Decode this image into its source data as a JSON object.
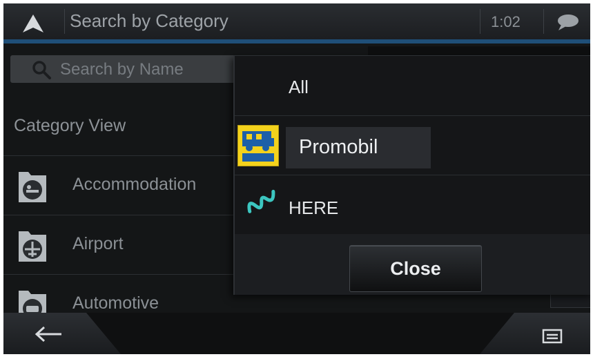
{
  "header": {
    "title": "Search by Category",
    "clock": "1:02"
  },
  "search": {
    "placeholder": "Search by Name"
  },
  "category_view": {
    "label": "Category View"
  },
  "categories": [
    {
      "label": "Accommodation",
      "icon": "bed-icon"
    },
    {
      "label": "Airport",
      "icon": "airplane-icon"
    },
    {
      "label": "Automotive",
      "icon": "car-icon"
    }
  ],
  "popup": {
    "options": [
      {
        "label": "All"
      },
      {
        "label": "Promobil",
        "logo": "promobil-logo"
      },
      {
        "label": "HERE",
        "logo": "here-logo"
      }
    ],
    "close_label": "Close"
  },
  "colors": {
    "accent_blue": "#1f4f78",
    "promobil_yellow": "#f4d21c",
    "here_teal": "#3cc6c0"
  }
}
